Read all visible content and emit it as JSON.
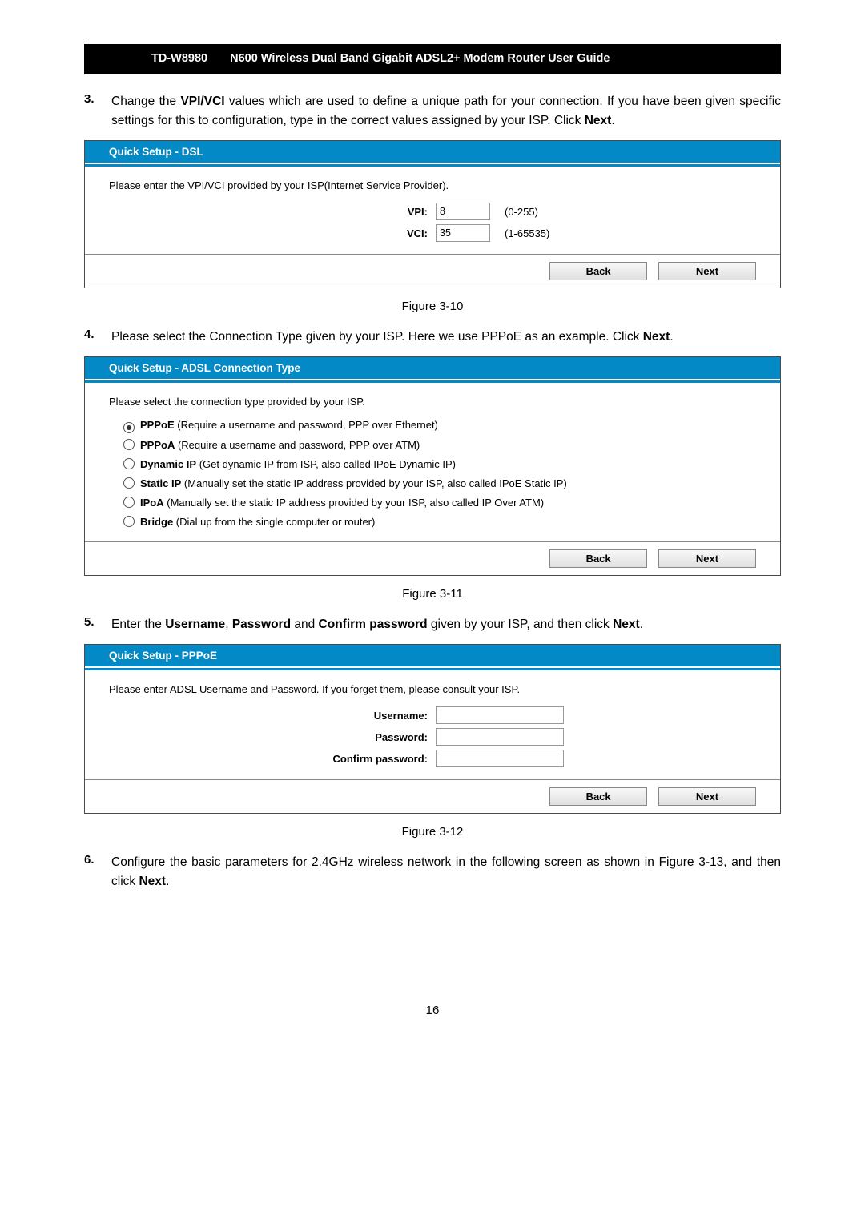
{
  "header": {
    "model": "TD-W8980",
    "title": "N600 Wireless Dual Band Gigabit ADSL2+ Modem Router User Guide"
  },
  "steps": {
    "s3": {
      "num": "3.",
      "text_pre": "Change the ",
      "bold1": "VPI/VCI",
      "text_mid": " values which are used to define a unique path for your connection. If you have been given specific settings for this to configuration, type in the correct values assigned by your ISP. Click ",
      "bold2": "Next",
      "text_end": "."
    },
    "s4": {
      "num": "4.",
      "text_pre": "Please select the Connection Type given by your ISP. Here we use PPPoE as an example. Click ",
      "bold1": "Next",
      "text_end": "."
    },
    "s5": {
      "num": "5.",
      "text_pre": "Enter the ",
      "bold1": "Username",
      "sep1": ", ",
      "bold2": "Password",
      "sep2": " and ",
      "bold3": "Confirm password",
      "text_mid": " given by your ISP, and then click ",
      "bold4": "Next",
      "text_end": "."
    },
    "s6": {
      "num": "6.",
      "text_pre": "Configure the basic parameters for 2.4GHz wireless network in the following screen as shown in Figure 3-13, and then click ",
      "bold1": "Next",
      "text_end": "."
    }
  },
  "panel_dsl": {
    "title": "Quick Setup - DSL",
    "desc": "Please enter the VPI/VCI provided by your ISP(Internet Service Provider).",
    "vpi_label": "VPI:",
    "vpi_value": "8",
    "vpi_range": "(0-255)",
    "vci_label": "VCI:",
    "vci_value": "35",
    "vci_range": "(1-65535)",
    "back": "Back",
    "next": "Next"
  },
  "fig310": "Figure 3-10",
  "panel_conn": {
    "title": "Quick Setup - ADSL Connection Type",
    "desc": "Please select the connection type provided by your ISP.",
    "options": [
      {
        "name": "PPPoE",
        "desc": " (Require a username and password, PPP over Ethernet)",
        "selected": true
      },
      {
        "name": "PPPoA",
        "desc": " (Require a username and password, PPP over ATM)",
        "selected": false
      },
      {
        "name": "Dynamic IP",
        "desc": " (Get dynamic IP from ISP, also called IPoE Dynamic IP)",
        "selected": false
      },
      {
        "name": "Static IP",
        "desc": " (Manually set the static IP address provided by your ISP, also called IPoE Static IP)",
        "selected": false
      },
      {
        "name": "IPoA",
        "desc": " (Manually set the static IP address provided by your ISP, also called IP Over ATM)",
        "selected": false
      },
      {
        "name": "Bridge",
        "desc": " (Dial up from the single computer or router)",
        "selected": false
      }
    ],
    "back": "Back",
    "next": "Next"
  },
  "fig311": "Figure 3-11",
  "panel_pppoe": {
    "title": "Quick Setup - PPPoE",
    "desc": "Please enter ADSL Username and Password. If you forget them, please consult your ISP.",
    "u_label": "Username:",
    "p_label": "Password:",
    "c_label": "Confirm password:",
    "back": "Back",
    "next": "Next"
  },
  "fig312": "Figure 3-12",
  "page_number": "16"
}
